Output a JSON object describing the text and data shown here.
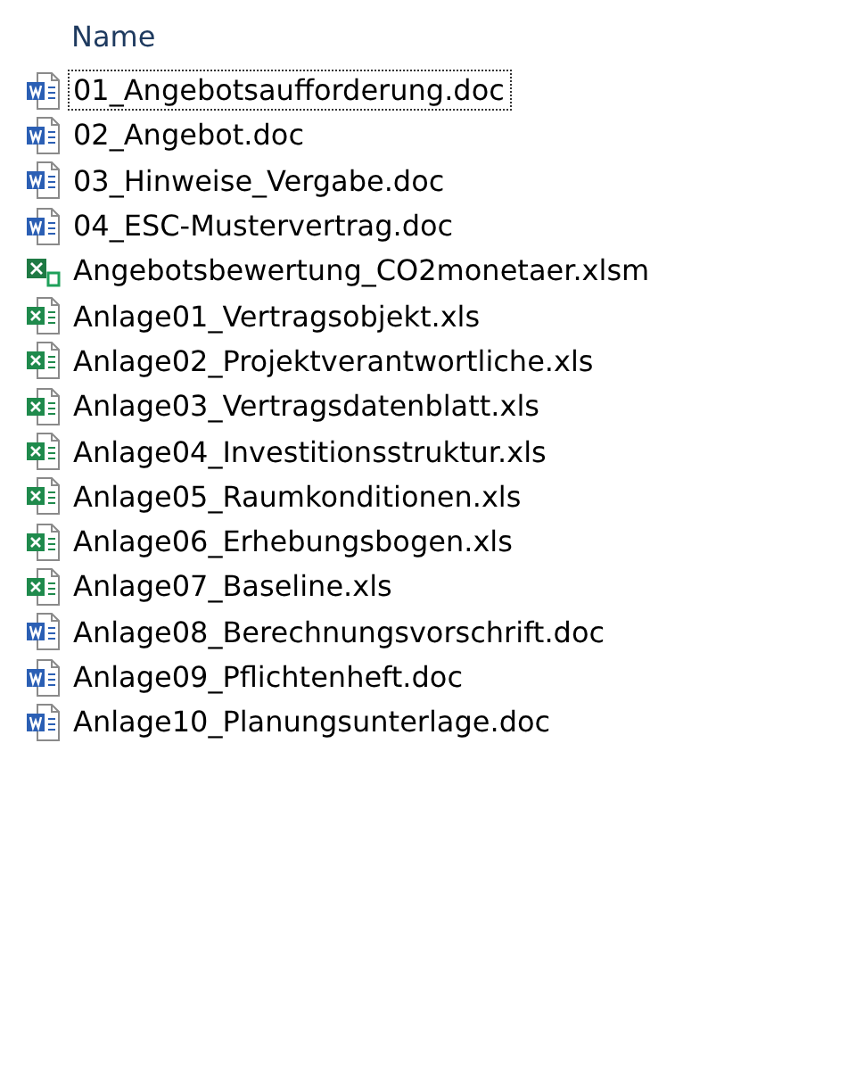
{
  "column_header": "Name",
  "files": [
    {
      "name": "01_Angebotsaufforderung.doc",
      "kind": "word",
      "focused": true
    },
    {
      "name": "02_Angebot.doc",
      "kind": "word",
      "focused": false
    },
    {
      "name": "03_Hinweise_Vergabe.doc",
      "kind": "word",
      "focused": false
    },
    {
      "name": "04_ESC-Mustervertrag.doc",
      "kind": "word",
      "focused": false
    },
    {
      "name": "Angebotsbewertung_CO2monetaer.xlsm",
      "kind": "macro",
      "focused": false
    },
    {
      "name": "Anlage01_Vertragsobjekt.xls",
      "kind": "excel",
      "focused": false
    },
    {
      "name": "Anlage02_Projektverantwortliche.xls",
      "kind": "excel",
      "focused": false
    },
    {
      "name": "Anlage03_Vertragsdatenblatt.xls",
      "kind": "excel",
      "focused": false
    },
    {
      "name": "Anlage04_Investitionsstruktur.xls",
      "kind": "excel",
      "focused": false
    },
    {
      "name": "Anlage05_Raumkonditionen.xls",
      "kind": "excel",
      "focused": false
    },
    {
      "name": "Anlage06_Erhebungsbogen.xls",
      "kind": "excel",
      "focused": false
    },
    {
      "name": "Anlage07_Baseline.xls",
      "kind": "excel",
      "focused": false
    },
    {
      "name": "Anlage08_Berechnungsvorschrift.doc",
      "kind": "word",
      "focused": false
    },
    {
      "name": "Anlage09_Pflichtenheft.doc",
      "kind": "word",
      "focused": false
    },
    {
      "name": "Anlage10_Planungsunterlage.doc",
      "kind": "word",
      "focused": false
    }
  ]
}
